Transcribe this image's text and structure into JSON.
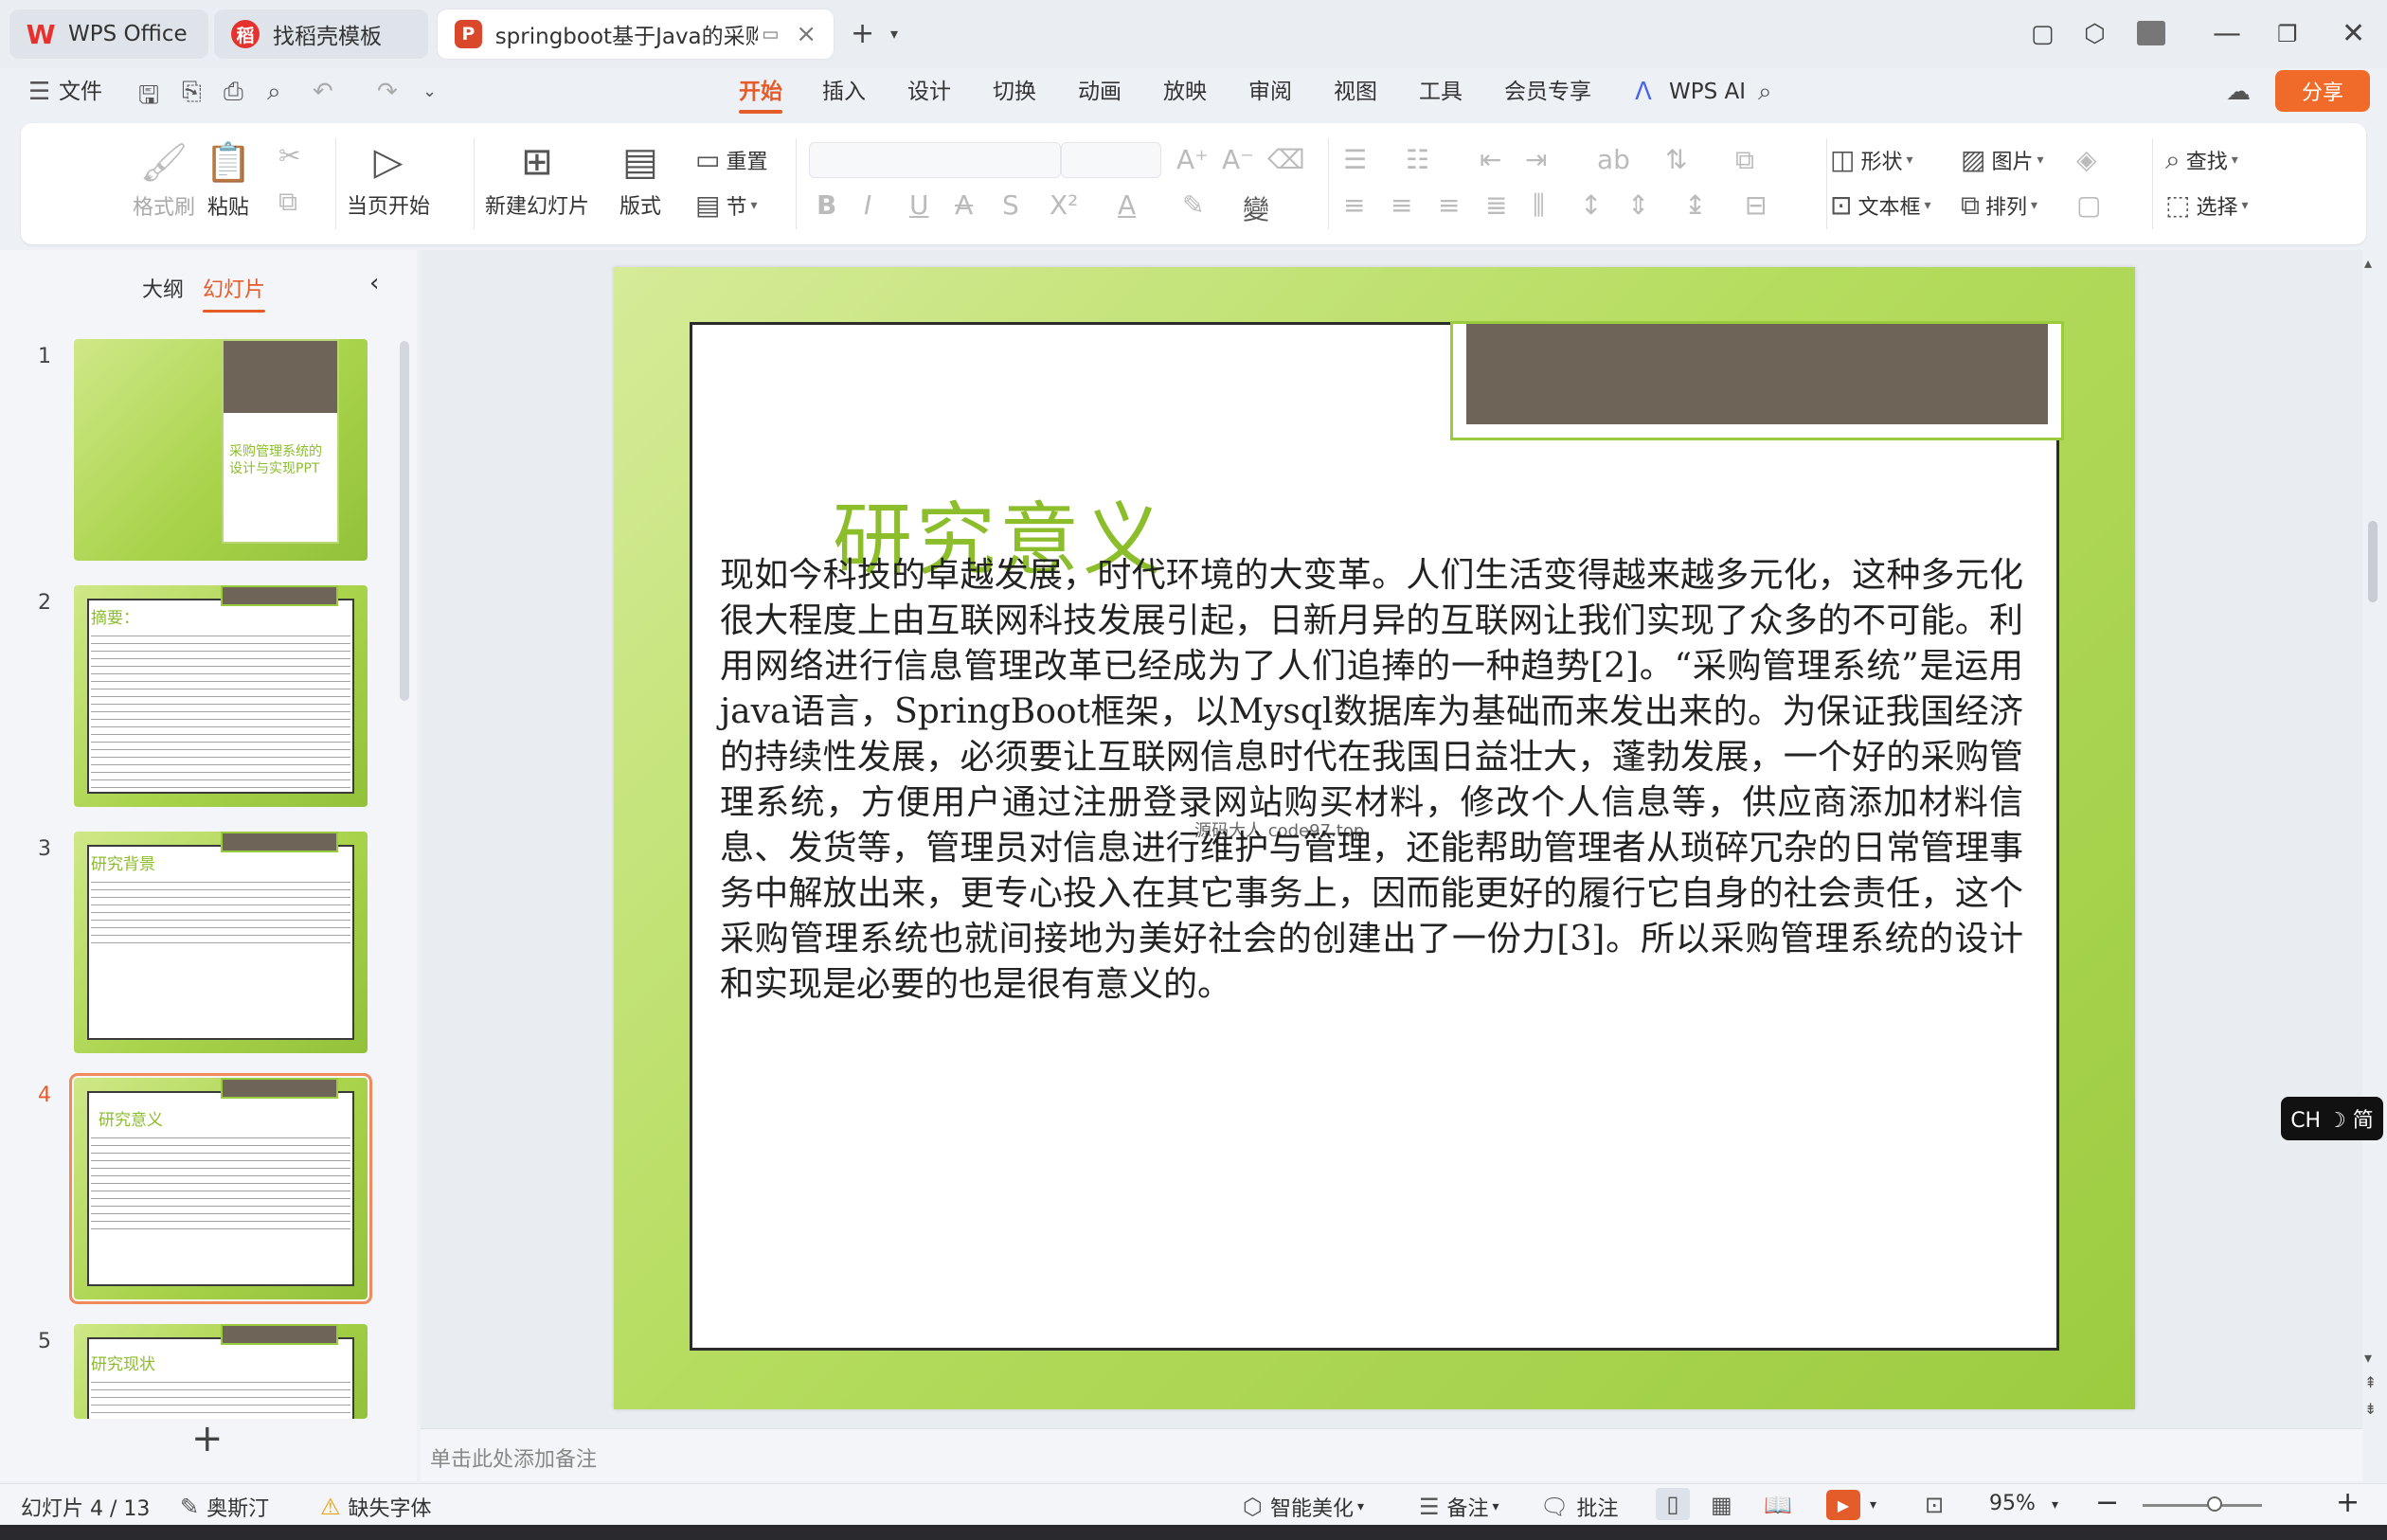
{
  "titlebar": {
    "tabs": [
      {
        "label": "WPS Office",
        "logo": "W"
      },
      {
        "label": "找稻壳模板",
        "logo": "稻"
      },
      {
        "label": "springboot基于Java的采购管理系统",
        "logo": "P"
      }
    ],
    "new_tab": "+"
  },
  "menu": {
    "file": "文件",
    "items": [
      "开始",
      "插入",
      "设计",
      "切换",
      "动画",
      "放映",
      "审阅",
      "视图",
      "工具",
      "会员专享"
    ],
    "ai": "WPS AI",
    "share": "分享"
  },
  "ribbon": {
    "format_painter": "格式刷",
    "paste": "粘贴",
    "play_from_current": "当页开始",
    "new_slide": "新建幻灯片",
    "layout": "版式",
    "reset": "重置",
    "section": "节",
    "shape": "形状",
    "picture": "图片",
    "textbox": "文本框",
    "arrange": "排列",
    "find": "查找",
    "select": "选择"
  },
  "panel": {
    "tab_outline": "大纲",
    "tab_slides": "幻灯片",
    "slides": [
      {
        "num": "1",
        "title": "采购管理系统的设计与实现PPT"
      },
      {
        "num": "2",
        "title": "摘要："
      },
      {
        "num": "3",
        "title": "研究背景"
      },
      {
        "num": "4",
        "title": "研究意义"
      },
      {
        "num": "5",
        "title": "研究现状"
      }
    ]
  },
  "slide": {
    "title": "研究意义",
    "body": "现如今科技的卓越发展，时代环境的大变革。人们生活变得越来越多元化，这种多元化很大程度上由互联网科技发展引起，日新月异的互联网让我们实现了众多的不可能。利用网络进行信息管理改革已经成为了人们追捧的一种趋势[2]。“采购管理系统”是运用java语言，SpringBoot框架，以Mysql数据库为基础而来发出来的。为保证我国经济的持续性发展，必须要让互联网信息时代在我国日益壮大，蓬勃发展，一个好的采购管理系统，方便用户通过注册登录网站购买材料，修改个人信息等，供应商添加材料信息、发货等，管理员对信息进行维护与管理，还能帮助管理者从琐碎冗杂的日常管理事务中解放出来，更专心投入在其它事务上，因而能更好的履行它自身的社会责任，这个采购管理系统也就间接地为美好社会的创建出了一份力[3]。所以采购管理系统的设计和实现是必要的也是很有意义的。",
    "watermark": "源码大人 code97.top"
  },
  "ime": "CH ☽ 简",
  "notes_placeholder": "单击此处添加备注",
  "status": {
    "slide_count": "幻灯片 4 / 13",
    "theme": "奥斯汀",
    "missing_font": "缺失字体",
    "smart_beautify": "智能美化",
    "notes": "备注",
    "comments": "批注",
    "zoom": "95%",
    "zoom_level": 0.6
  },
  "colors": {
    "accent": "#e55c2b",
    "slide_title": "#8cbd2b",
    "slide_green": "#a9d34b",
    "tab_dark": "#6e6558"
  }
}
